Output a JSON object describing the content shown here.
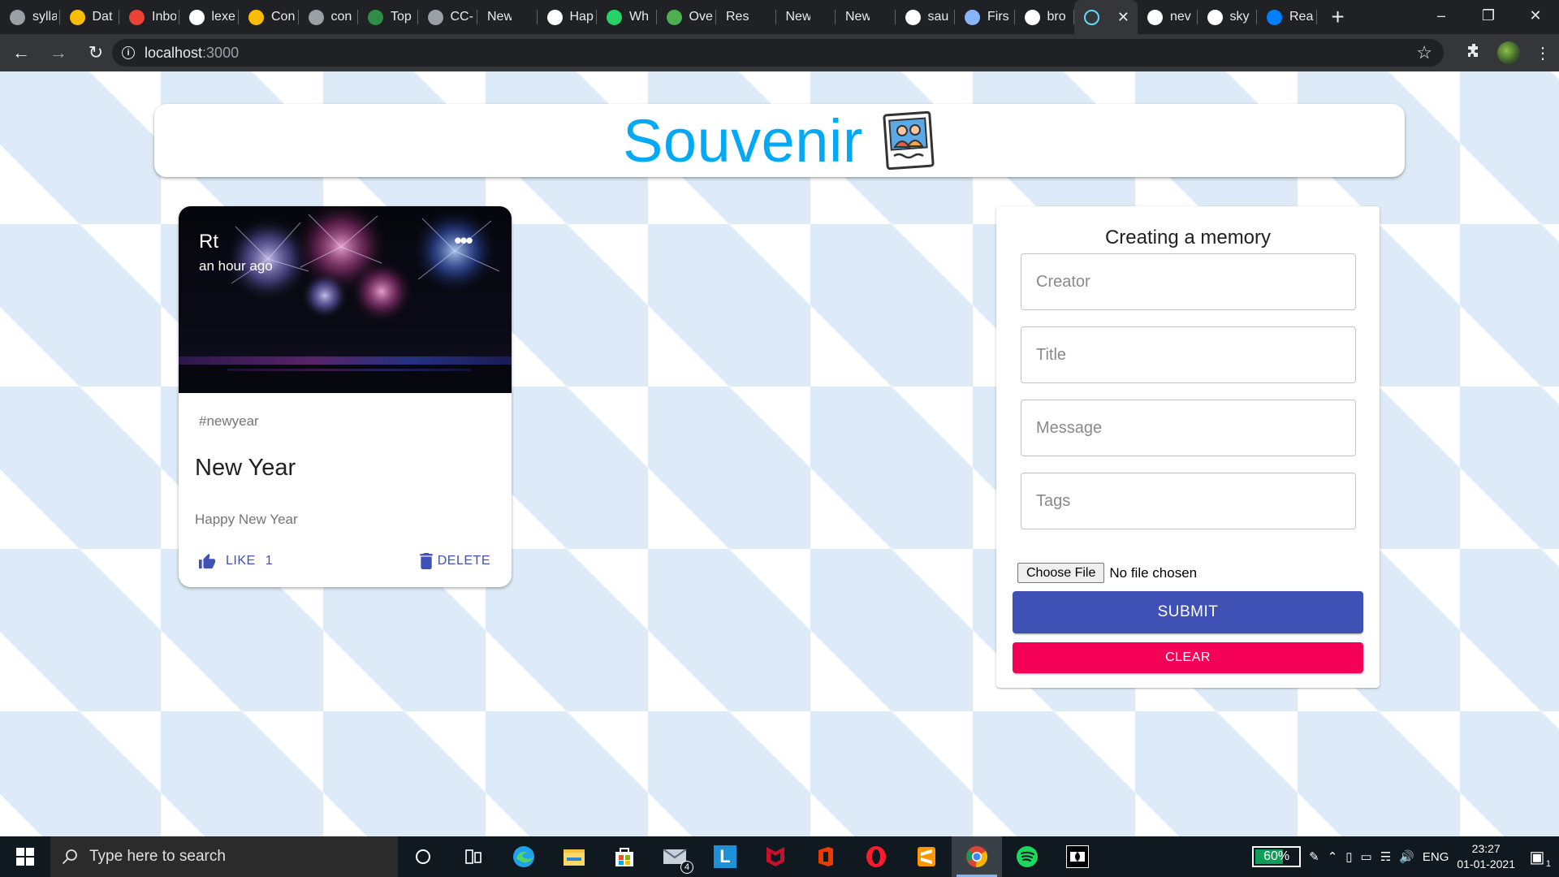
{
  "browser": {
    "tabs": [
      {
        "label": "sylla",
        "icon": "globe-icon",
        "color": "#9aa0a6"
      },
      {
        "label": "Dat",
        "icon": "google-drive-icon",
        "color": "#fbbc04"
      },
      {
        "label": "Inbo",
        "icon": "gmail-icon",
        "color": "#ea4335"
      },
      {
        "label": "lexe",
        "icon": "google-icon",
        "color": "#ffffff"
      },
      {
        "label": "Con",
        "icon": "google-drive-icon",
        "color": "#fbbc04"
      },
      {
        "label": "con",
        "icon": "globe-icon",
        "color": "#9aa0a6"
      },
      {
        "label": "Top",
        "icon": "geeksforgeeks-icon",
        "color": "#2f8d46"
      },
      {
        "label": "CC-",
        "icon": "globe-icon",
        "color": "#9aa0a6"
      },
      {
        "label": "New Tab",
        "icon": "",
        "color": ""
      },
      {
        "label": "Hap",
        "icon": "google-icon",
        "color": "#ffffff"
      },
      {
        "label": "Wh",
        "icon": "whatsapp-icon",
        "color": "#25d366"
      },
      {
        "label": "Ove",
        "icon": "leaf-icon",
        "color": "#4caf50"
      },
      {
        "label": "Res",
        "icon": "",
        "color": ""
      },
      {
        "label": "New Tab",
        "icon": "",
        "color": ""
      },
      {
        "label": "New Tab",
        "icon": "",
        "color": ""
      },
      {
        "label": "sau",
        "icon": "github-icon",
        "color": "#ffffff"
      },
      {
        "label": "Firs",
        "icon": "image-icon",
        "color": "#8ab4f8"
      },
      {
        "label": "bro",
        "icon": "github-icon",
        "color": "#ffffff"
      },
      {
        "label": "",
        "icon": "react-icon",
        "color": "#61dafb",
        "active": true
      },
      {
        "label": "nev",
        "icon": "google-icon",
        "color": "#ffffff"
      },
      {
        "label": "sky",
        "icon": "google-icon",
        "color": "#ffffff"
      },
      {
        "label": "Rea",
        "icon": "mui-icon",
        "color": "#007fff"
      }
    ],
    "url_host": "localhost",
    "url_port": ":3000"
  },
  "app": {
    "brand": "Souvenir",
    "brand_color": "#03a9f4",
    "post": {
      "creator": "Rt",
      "time": "an hour ago",
      "tags": "#newyear",
      "title": "New Year",
      "message": "Happy New Year",
      "like_label": "LIKE",
      "like_count": "1",
      "delete_label": "DELETE"
    },
    "form": {
      "title": "Creating a memory",
      "creator_placeholder": "Creator",
      "title_placeholder": "Title",
      "message_placeholder": "Message",
      "tags_placeholder": "Tags",
      "choose_file_label": "Choose File",
      "no_file_label": "No file chosen",
      "submit_label": "SUBMIT",
      "clear_label": "CLEAR",
      "primary_color": "#3f51b5",
      "secondary_color": "#f50057"
    }
  },
  "taskbar": {
    "search_placeholder": "Type here to search",
    "mail_badge": "4",
    "battery_percent": "60%",
    "battery_level": 0.6,
    "language": "ENG",
    "time": "23:27",
    "date": "01-01-2021",
    "notification_count": "1"
  }
}
